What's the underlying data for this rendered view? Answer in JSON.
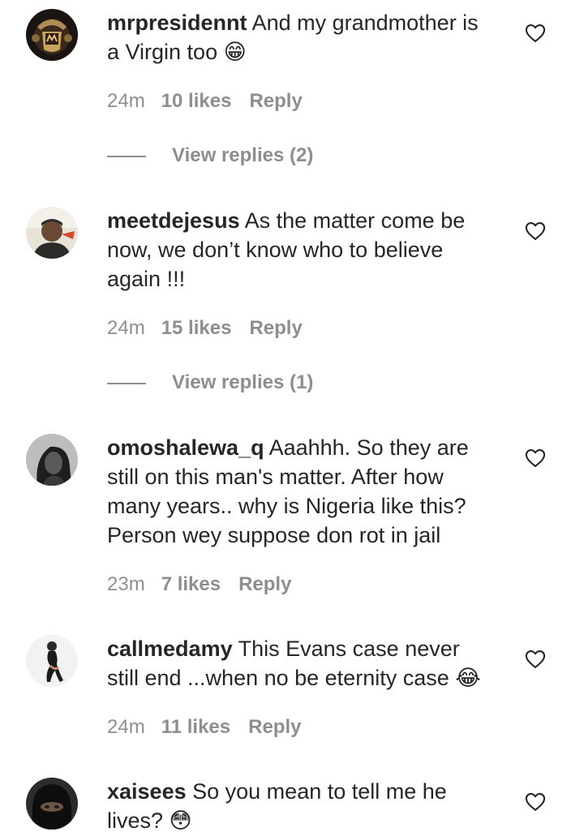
{
  "comments": [
    {
      "username": "mrpresidennt",
      "text": "And my grandmother is a Virgin too",
      "emoji": "😁",
      "time": "24m",
      "likes": "10 likes",
      "reply": "Reply",
      "view_replies": "View replies (2)",
      "avatar": "logo-crest-avatar"
    },
    {
      "username": "meetdejesus",
      "text": "As the matter come be now, we don’t know who to believe again !!!",
      "emoji": "",
      "time": "24m",
      "likes": "15 likes",
      "reply": "Reply",
      "view_replies": "View replies (1)",
      "avatar": "person-photo-avatar"
    },
    {
      "username": "omoshalewa_q",
      "text": "Aaahhh. So they are still on this man's matter. After how many years.. why is Nigeria like this? Person wey suppose don rot in jail",
      "emoji": "",
      "time": "23m",
      "likes": "7 likes",
      "reply": "Reply",
      "avatar": "person-photo-avatar"
    },
    {
      "username": "callmedamy",
      "text": "This Evans case never still end ...when no be eternity case",
      "emoji": "😂",
      "time": "24m",
      "likes": "11 likes",
      "reply": "Reply",
      "avatar": "person-photo-avatar"
    },
    {
      "username": "xaisees",
      "text": "So you mean to tell me he lives?",
      "emoji": "😳",
      "avatar": "person-photo-avatar"
    }
  ],
  "icons": {
    "like": "heart-outline-icon"
  },
  "colors": {
    "text": "#262626",
    "secondary": "#8e8e8e",
    "background": "#ffffff"
  }
}
